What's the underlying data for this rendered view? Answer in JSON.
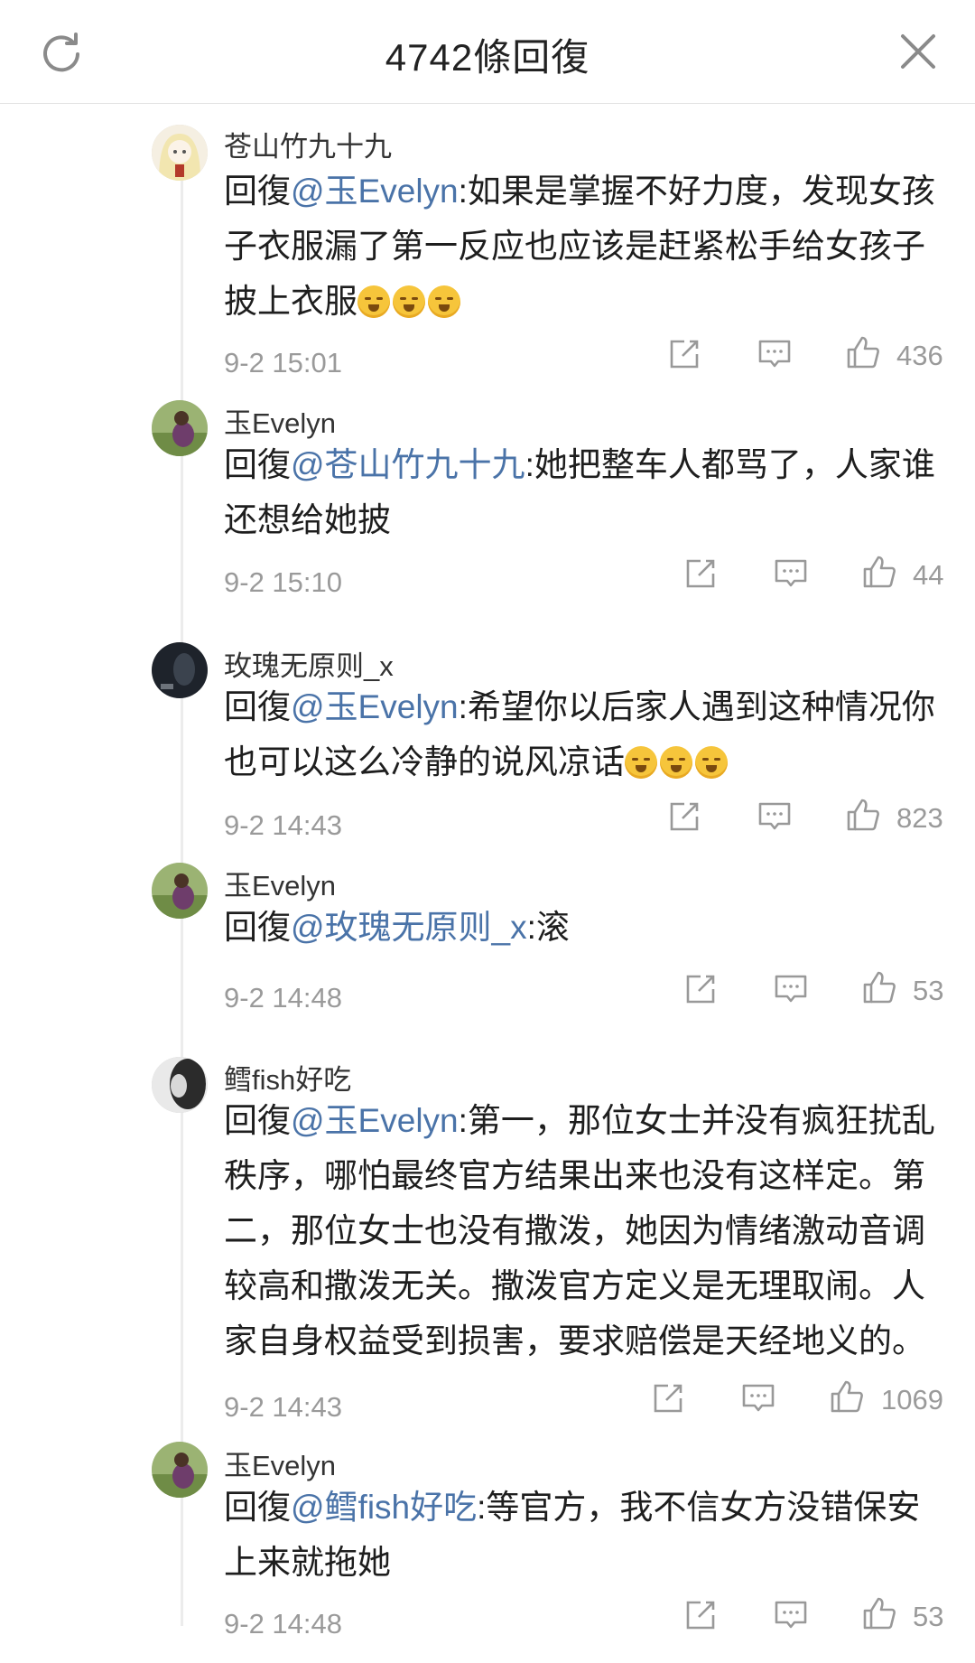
{
  "header": {
    "title": "4742條回復",
    "refresh_icon": "refresh-icon",
    "close_icon": "close-icon"
  },
  "reply_prefix": "回復",
  "comments": [
    {
      "name": "苍山竹九十九",
      "mention": "@玉Evelyn",
      "body": ":如果是掌握不好力度，发现女孩子衣服漏了第一反应也应该是赶紧松手给女孩子披上衣服",
      "emoji_count": 3,
      "time": "9-2 15:01",
      "likes": "436"
    },
    {
      "name": "玉Evelyn",
      "mention": "@苍山竹九十九",
      "body": ":她把整车人都骂了，人家谁还想给她披",
      "emoji_count": 0,
      "time": "9-2 15:10",
      "likes": "44"
    },
    {
      "name": "玫瑰无原则_x",
      "mention": "@玉Evelyn",
      "body": ":希望你以后家人遇到这种情况你也可以这么冷静的说风凉话",
      "emoji_count": 3,
      "time": "9-2 14:43",
      "likes": "823"
    },
    {
      "name": "玉Evelyn",
      "mention": "@玫瑰无原则_x",
      "body": ":滚",
      "emoji_count": 0,
      "time": "9-2 14:48",
      "likes": "53"
    },
    {
      "name": "鳕fish好吃",
      "mention": "@玉Evelyn",
      "body": ":第一，那位女士并没有疯狂扰乱秩序，哪怕最终官方结果出来也没有这样定。第二，那位女士也没有撒泼，她因为情绪激动音调较高和撒泼无关。撒泼官方定义是无理取闹。人家自身权益受到损害，要求赔偿是天经地义的。",
      "emoji_count": 0,
      "time": "9-2 14:43",
      "likes": "1069"
    },
    {
      "name": "玉Evelyn",
      "mention": "@鳕fish好吃",
      "body": ":等官方，我不信女方没错保安上来就拖她",
      "emoji_count": 0,
      "time": "9-2 14:48",
      "likes": "53"
    }
  ],
  "action_icons": [
    "share-icon",
    "comment-icon",
    "like-icon"
  ]
}
